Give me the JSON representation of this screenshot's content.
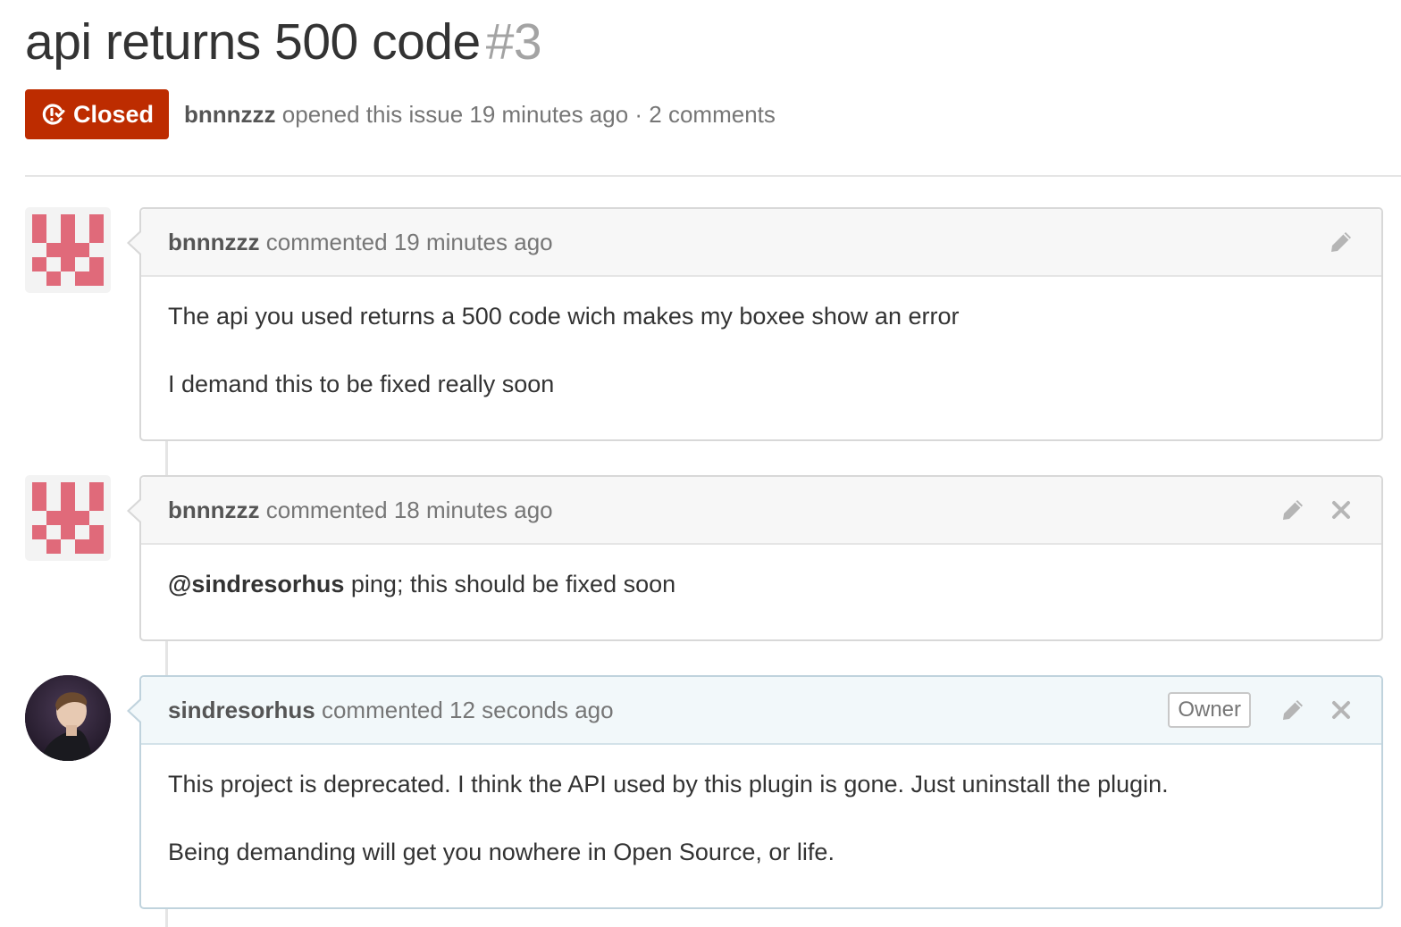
{
  "issue": {
    "title": "api returns 500 code",
    "number": "#3",
    "state": "Closed",
    "author": "bnnnzzz",
    "opened_text": "opened this issue 19 minutes ago · 2 comments"
  },
  "colors": {
    "closed": "#bd2c00",
    "identicon": "#e06a7a"
  },
  "comments": [
    {
      "author": "bnnnzzz",
      "meta": "commented 19 minutes ago",
      "body": [
        "The api you used returns a 500 code wich makes my boxee show an error",
        "I demand this to be fixed really soon"
      ]
    },
    {
      "author": "bnnnzzz",
      "meta": "commented 18 minutes ago",
      "mention": "@sindresorhus",
      "body_after_mention": "ping; this should be fixed soon"
    },
    {
      "author": "sindresorhus",
      "meta": "commented 12 seconds ago",
      "badge": "Owner",
      "body": [
        "This project is deprecated. I think the API used by this plugin is gone. Just uninstall the plugin.",
        "Being demanding will get you nowhere in Open Source, or life."
      ]
    }
  ],
  "icons": {
    "state": "issue-closed-icon",
    "edit": "pencil-icon",
    "delete": "close-icon"
  }
}
